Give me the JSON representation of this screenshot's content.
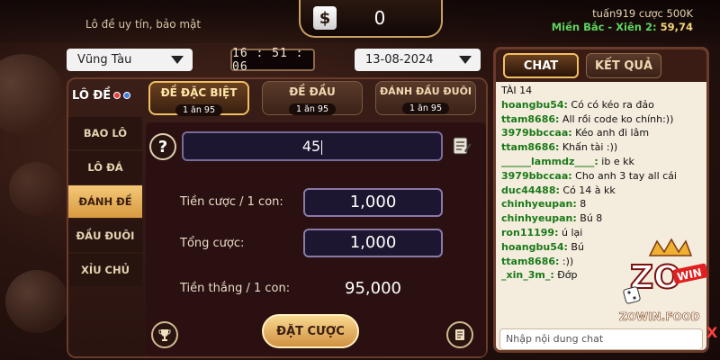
{
  "header": {
    "subtitle": "Lô đề uy tín, bảo mật",
    "balance": "0",
    "user_line": "tuấn919 cược 500K",
    "region": "Miền Bắc - Xiên 2:",
    "region_value": "59,74"
  },
  "selectors": {
    "province": "Vũng Tàu",
    "time": "16 : 51 : 06",
    "date": "13-08-2024"
  },
  "game": {
    "logo": "LÔ ĐỀ",
    "tabs": [
      {
        "label": "ĐỀ ĐẶC BIỆT",
        "sub": "1 ăn 95"
      },
      {
        "label": "ĐỀ ĐẦU",
        "sub": "1 ăn 95"
      },
      {
        "label": "ĐÁNH ĐẦU ĐUÔI",
        "sub": "1 ăn 95"
      }
    ],
    "side_menu": [
      "BAO LÔ",
      "LÔ ĐÁ",
      "ĐÁNH ĐỀ",
      "ĐẦU ĐUÔI",
      "XỈU CHỦ"
    ],
    "help": "?",
    "number": "45",
    "bet_per_label": "Tiền cược / 1 con:",
    "bet_per_value": "1,000",
    "total_label": "Tổng cược:",
    "total_value": "1,000",
    "win_label": "Tiền thắng / 1 con:",
    "win_value": "95,000",
    "bet_button": "ĐẶT CƯỢC"
  },
  "chat": {
    "tabs": [
      "CHAT",
      "KẾT QUẢ"
    ],
    "messages": [
      {
        "user": "",
        "text": "TÀI 14"
      },
      {
        "user": "hoangbu54:",
        "text": " Có có kéo ra đảo"
      },
      {
        "user": "ttam8686:",
        "text": " All rồi code ko chính:))"
      },
      {
        "user": "3979bbccaa:",
        "text": " Kéo anh đi lâm"
      },
      {
        "user": "ttam8686:",
        "text": " Khấn tài :))"
      },
      {
        "user": "______lammdz____:",
        "text": " ib e kk"
      },
      {
        "user": "3979bbccaa:",
        "text": " Cho anh 3 tay all cái"
      },
      {
        "user": "duc44488:",
        "text": " Có 14 à kk"
      },
      {
        "user": "chinhyeupan:",
        "text": " 8"
      },
      {
        "user": "chinhyeupan:",
        "text": " Bú 8"
      },
      {
        "user": "ron11199:",
        "text": " ú lại"
      },
      {
        "user": "hoangbu54:",
        "text": " Bú"
      },
      {
        "user": "ttam8686:",
        "text": " :))"
      },
      {
        "user": "_xin_3m_:",
        "text": " Đớp"
      }
    ],
    "placeholder": "Nhập nội dung chat",
    "close": "X"
  },
  "watermark": {
    "text": "ZOWIN.FOOD",
    "brand": "ZO",
    "badge": "WIN"
  },
  "colors": {
    "accent_gold": "#f0c060",
    "chat_user_green": "#1a7a1a",
    "region_green": "#5fd35f"
  }
}
